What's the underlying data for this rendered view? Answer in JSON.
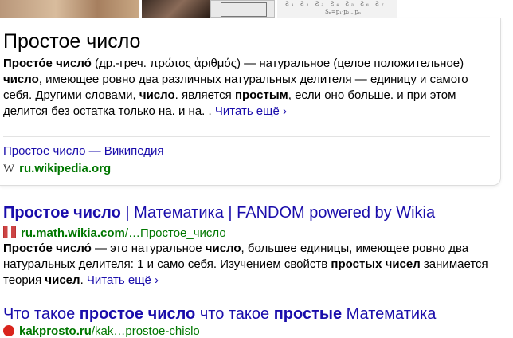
{
  "card": {
    "title": "Простое число",
    "snippet": {
      "term": "Просто́е число́",
      "etym": " (др.-греч. πρώτος ἀριθμός) — натуральное (целое положительное) ",
      "b1": "число",
      "t1": ", имеющее ровно два различных натуральных делителя — единицу и самого себя. Другими словами, ",
      "b2": "число",
      "t2": ". является ",
      "b3": "простым",
      "t3": ", если оно больше. и при этом делится без остатка только на. и на. . ",
      "more": "Читать ещё ›"
    },
    "source_link": "Простое число — Википедия",
    "source_icon": "W",
    "source_domain": "ru.wikipedia.org"
  },
  "results": [
    {
      "title_bold": "Простое число",
      "title_rest": " | Математика | FANDOM powered by Wikia",
      "domain": "ru.math.wikia.com",
      "path": "/…Простое_число",
      "snippet": {
        "term": "Просто́е число́",
        "t0": " — это натуральное ",
        "b1": "число",
        "t1": ", большее единицы, имеющее ровно два натуральных делителя: 1 и само себя. Изучением свойств ",
        "b2": "простых чисел",
        "t2": " занимается теория ",
        "b3": "чисел",
        "t3": ". ",
        "more": "Читать ещё ›"
      }
    },
    {
      "title_p1": "Что такое ",
      "title_b1": "простое число",
      "title_p2": " что такое ",
      "title_b2": "простые",
      "title_p3": " Математика",
      "domain": "kakprosto.ru",
      "path": "/kak…prostoe-chislo"
    }
  ],
  "colors": {
    "link": "#1a0dab",
    "url": "#007700"
  }
}
